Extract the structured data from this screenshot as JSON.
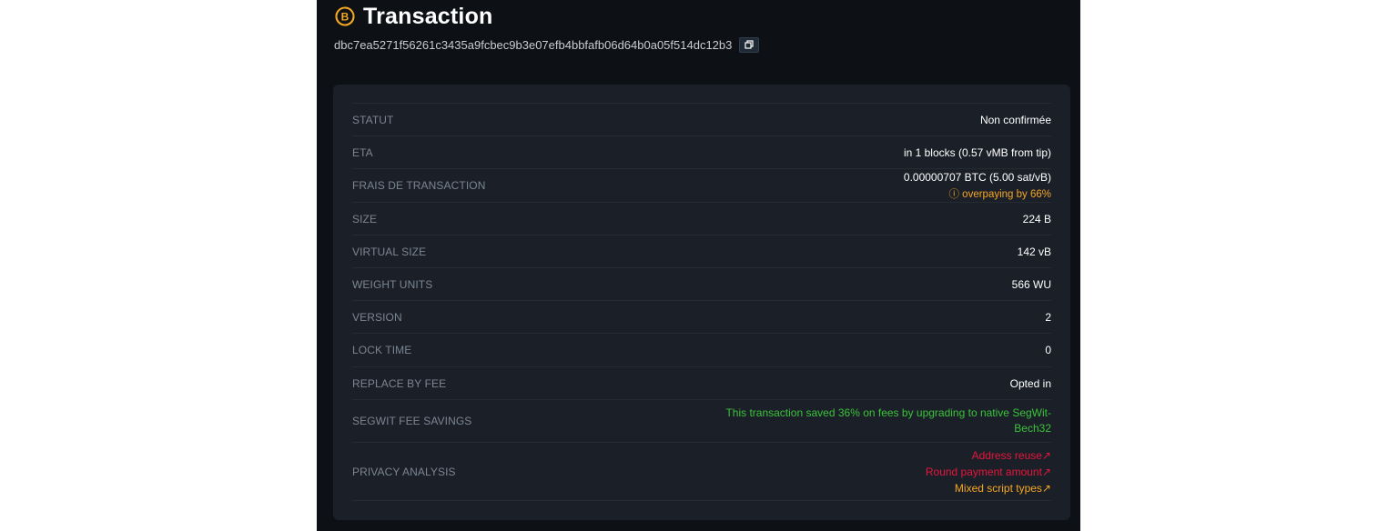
{
  "header": {
    "title": "Transaction",
    "icon": "bitcoin-icon",
    "txid": "dbc7ea5271f56261c3435a9fcbec9b3e07efb4bbfafb06d64b0a05f514dc12b3",
    "copy_icon": "copy-icon"
  },
  "details": {
    "status": {
      "label": "STATUT",
      "value": "Non confirmée"
    },
    "eta": {
      "label": "ETA",
      "value": "in 1 blocks (0.57 vMB from tip)"
    },
    "fee": {
      "label": "FRAIS DE TRANSACTION",
      "value": "0.00000707 BTC (5.00 sat/vB)",
      "warning": "ⓘ overpaying by 66%"
    },
    "size": {
      "label": "SIZE",
      "value": "224 B"
    },
    "vsize": {
      "label": "VIRTUAL SIZE",
      "value": "142 vB"
    },
    "weight": {
      "label": "WEIGHT UNITS",
      "value": "566 WU"
    },
    "version": {
      "label": "VERSION",
      "value": "2"
    },
    "locktime": {
      "label": "LOCK TIME",
      "value": "0"
    },
    "rbf": {
      "label": "REPLACE BY FEE",
      "value": "Opted in"
    },
    "segwit": {
      "label": "SEGWIT FEE SAVINGS",
      "line1": "This transaction saved 36% on fees by upgrading to native SegWit-",
      "line2": "Bech32"
    },
    "privacy": {
      "label": "PRIVACY ANALYSIS",
      "items": [
        "Address reuse↗",
        "Round payment amount↗",
        "Mixed script types↗"
      ]
    }
  },
  "colors": {
    "background": "#0d1014",
    "card": "#1b2028",
    "accent_orange": "#f5a623",
    "warning_red": "#e5163c",
    "success_green": "#3bc23b"
  }
}
